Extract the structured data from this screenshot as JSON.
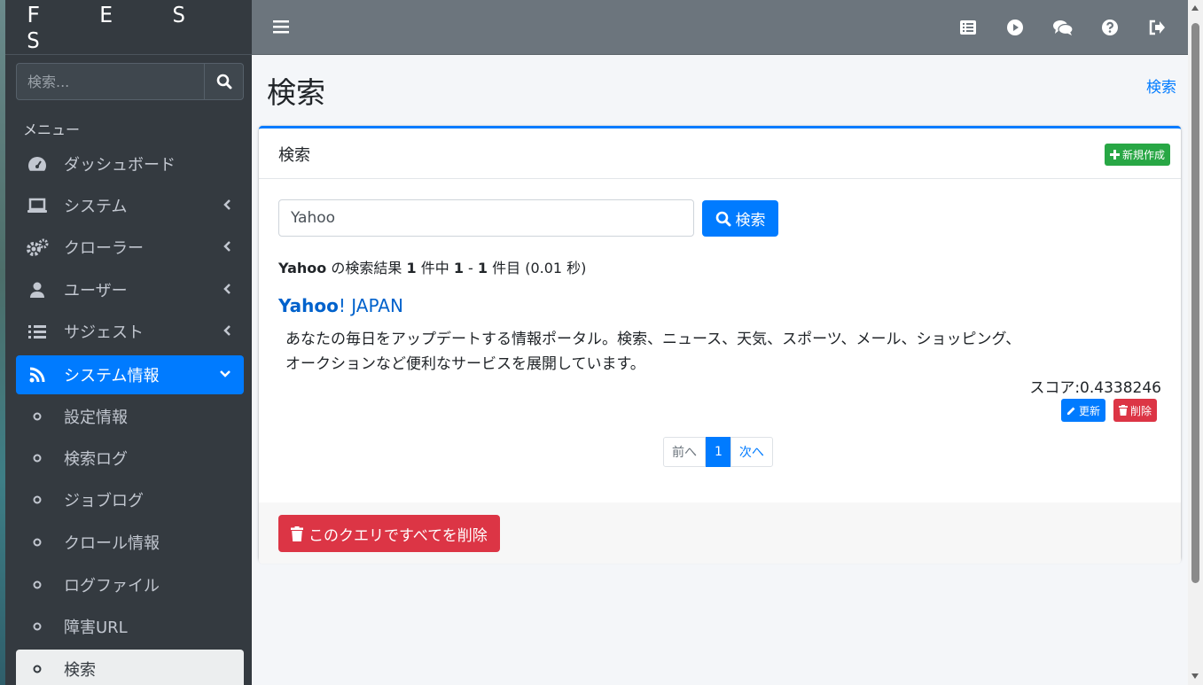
{
  "brand": "F E S S",
  "sidebar": {
    "search_placeholder": "検索...",
    "menu_header": "メニュー",
    "items": [
      {
        "label": "ダッシュボード"
      },
      {
        "label": "システム"
      },
      {
        "label": "クローラー"
      },
      {
        "label": "ユーザー"
      },
      {
        "label": "サジェスト"
      },
      {
        "label": "システム情報"
      }
    ],
    "subitems": [
      {
        "label": "設定情報"
      },
      {
        "label": "検索ログ"
      },
      {
        "label": "ジョブログ"
      },
      {
        "label": "クロール情報"
      },
      {
        "label": "ログファイル"
      },
      {
        "label": "障害URL"
      },
      {
        "label": "検索"
      }
    ]
  },
  "topbar": {
    "icons": [
      "list-icon",
      "play-icon",
      "comments-icon",
      "question-icon",
      "sign-out-icon"
    ]
  },
  "page": {
    "title": "検索",
    "breadcrumb": "検索"
  },
  "card": {
    "title": "検索",
    "new_button": "新規作成",
    "query_value": "Yahoo",
    "search_button": "検索",
    "summary": {
      "query": "Yahoo",
      "text1": " の検索結果 ",
      "total": "1",
      "text2": " 件中 ",
      "from": "1",
      "dash": " - ",
      "to": "1",
      "text3": " 件目 (0.01 秒)"
    },
    "result": {
      "title_bold": "Yahoo",
      "title_rest": "! JAPAN",
      "description": "あなたの毎日をアップデートする情報ポータル。検索、ニュース、天気、スポーツ、メール、ショッピング、オークションなど便利なサービスを展開しています。",
      "score": "スコア:0.4338246",
      "edit_button": "更新",
      "delete_button": "削除"
    },
    "pager": {
      "prev": "前へ",
      "current": "1",
      "next": "次へ"
    },
    "delete_all_button": "このクエリですべてを削除"
  },
  "colors": {
    "primary": "#007bff",
    "success": "#28a745",
    "danger": "#dc3545",
    "sidebar_bg": "#343a40",
    "topbar_bg": "#6c757d"
  }
}
